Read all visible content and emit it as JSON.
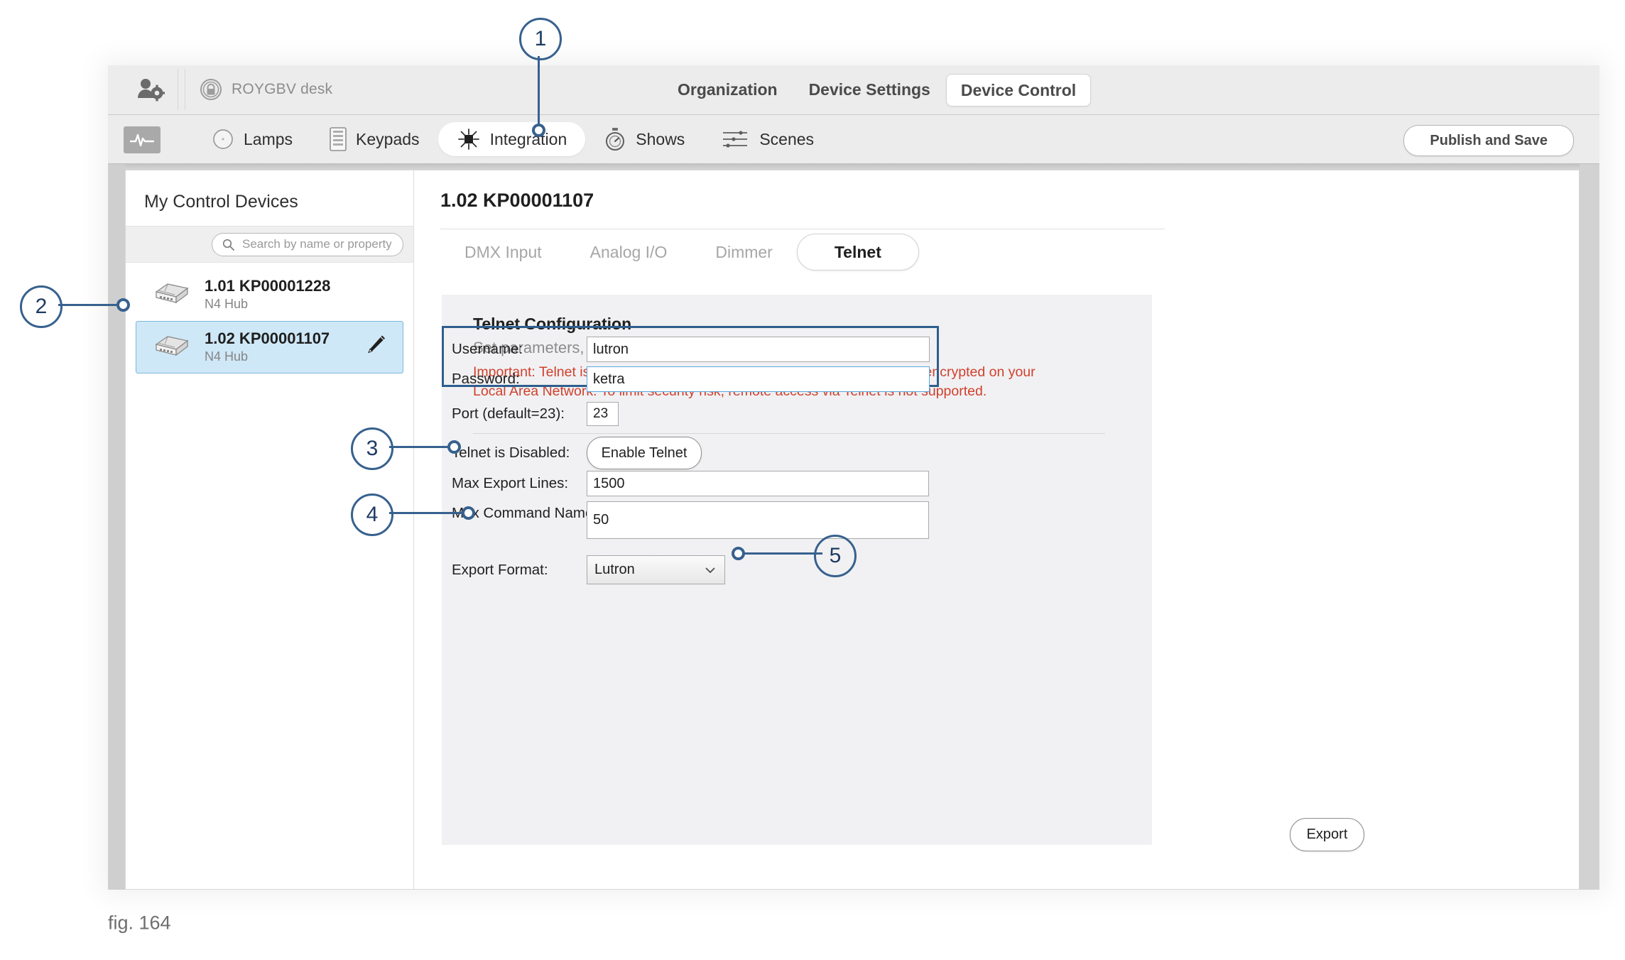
{
  "window": {
    "top_bar": {
      "user_settings_icon": "user-gear-icon",
      "lock_icon": "lock-circle-icon",
      "project_name": "ROYGBV desk",
      "nav": [
        {
          "label": "Organization",
          "active": false
        },
        {
          "label": "Device Settings",
          "active": false
        },
        {
          "label": "Device Control",
          "active": true
        }
      ]
    },
    "tool_bar": {
      "health_icon": "pulse-icon",
      "tabs": [
        {
          "label": "Lamps",
          "icon": "lamp-circle-icon",
          "active": false
        },
        {
          "label": "Keypads",
          "icon": "keypad-icon",
          "active": false
        },
        {
          "label": "Integration",
          "icon": "integration-chip-icon",
          "active": true
        },
        {
          "label": "Shows",
          "icon": "stopwatch-icon",
          "active": false
        },
        {
          "label": "Scenes",
          "icon": "sliders-icon",
          "active": false
        }
      ],
      "publish_save_label": "Publish and Save"
    },
    "sidebar": {
      "title": "My Control Devices",
      "search": {
        "placeholder": "Search by name or property",
        "value": "",
        "icon": "search-icon"
      },
      "devices": [
        {
          "name": "1.01 KP00001228",
          "type": "N4 Hub",
          "icon": "hub-device-icon",
          "selected": false,
          "editable": false
        },
        {
          "name": "1.02 KP00001107",
          "type": "N4 Hub",
          "icon": "hub-device-icon",
          "selected": true,
          "editable": true,
          "edit_icon": "pencil-icon"
        }
      ]
    },
    "main": {
      "page_title": "1.02 KP00001107",
      "tabs": [
        {
          "label": "DMX Input",
          "active": false
        },
        {
          "label": "Analog I/O",
          "active": false
        },
        {
          "label": "Dimmer",
          "active": false
        },
        {
          "label": "Telnet",
          "active": true
        }
      ],
      "config": {
        "title": "Telnet Configuration",
        "subtitle": "Set parameters, enable/disable support, export command sets",
        "warning": "Important: Telnet is not secure.  The username, password, and data is not encrypted on your Local Area Network.  To limit security risk, remote access via Telnet is not supported.",
        "warning_color": "#d0402c",
        "fields": {
          "username_label": "Username:",
          "username_value": "lutron",
          "password_label": "Password:",
          "password_value": "ketra",
          "port_label": "Port (default=23):",
          "port_value": "23",
          "telnet_state_label": "Telnet is Disabled:",
          "enable_telnet_label": "Enable Telnet",
          "max_export_lines_label": "Max Export Lines:",
          "max_export_lines_value": "1500",
          "max_command_name_length_label": "Max Command Name Length:",
          "max_command_name_length_value": "50",
          "export_format_label": "Export Format:",
          "export_format_value": "Lutron",
          "export_format_caret": "chevron-down-icon",
          "export_button_label": "Export"
        }
      }
    }
  },
  "callouts": [
    {
      "number": "1"
    },
    {
      "number": "2"
    },
    {
      "number": "3"
    },
    {
      "number": "4"
    },
    {
      "number": "5"
    }
  ],
  "figure": {
    "caption": "fig. 164"
  },
  "colors": {
    "callout": "#37618e",
    "selection": "#cfe8f7",
    "warning": "#d0402c",
    "highlight_border": "#2e5f8e"
  }
}
